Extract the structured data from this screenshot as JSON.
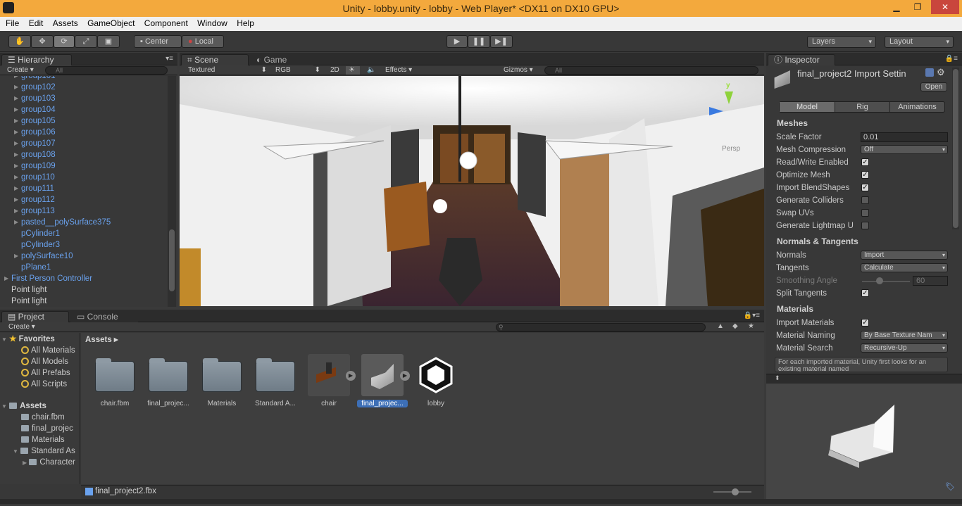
{
  "window": {
    "title": "Unity - lobby.unity - lobby - Web Player* <DX11 on DX10 GPU>"
  },
  "menu": [
    "File",
    "Edit",
    "Assets",
    "GameObject",
    "Component",
    "Window",
    "Help"
  ],
  "toolbar": {
    "pivot": "Center",
    "space": "Local",
    "layers": "Layers",
    "layout": "Layout"
  },
  "hierarchy": {
    "tab": "Hierarchy",
    "create": "Create",
    "search_placeholder": "All",
    "items": [
      {
        "label": "group101",
        "level": 1,
        "expandable": true,
        "prefab": true
      },
      {
        "label": "group102",
        "level": 1,
        "expandable": true,
        "prefab": true
      },
      {
        "label": "group103",
        "level": 1,
        "expandable": true,
        "prefab": true
      },
      {
        "label": "group104",
        "level": 1,
        "expandable": true,
        "prefab": true
      },
      {
        "label": "group105",
        "level": 1,
        "expandable": true,
        "prefab": true
      },
      {
        "label": "group106",
        "level": 1,
        "expandable": true,
        "prefab": true
      },
      {
        "label": "group107",
        "level": 1,
        "expandable": true,
        "prefab": true
      },
      {
        "label": "group108",
        "level": 1,
        "expandable": true,
        "prefab": true
      },
      {
        "label": "group109",
        "level": 1,
        "expandable": true,
        "prefab": true
      },
      {
        "label": "group110",
        "level": 1,
        "expandable": true,
        "prefab": true
      },
      {
        "label": "group111",
        "level": 1,
        "expandable": true,
        "prefab": true
      },
      {
        "label": "group112",
        "level": 1,
        "expandable": true,
        "prefab": true
      },
      {
        "label": "group113",
        "level": 1,
        "expandable": true,
        "prefab": true
      },
      {
        "label": "pasted__polySurface375",
        "level": 1,
        "expandable": true,
        "prefab": true
      },
      {
        "label": "pCylinder1",
        "level": 1,
        "expandable": false,
        "prefab": true
      },
      {
        "label": "pCylinder3",
        "level": 1,
        "expandable": false,
        "prefab": true
      },
      {
        "label": "polySurface10",
        "level": 1,
        "expandable": true,
        "prefab": true
      },
      {
        "label": "pPlane1",
        "level": 1,
        "expandable": false,
        "prefab": true
      },
      {
        "label": "First Person Controller",
        "level": 0,
        "expandable": true,
        "prefab": true
      },
      {
        "label": "Point light",
        "level": 0,
        "expandable": false,
        "prefab": false
      },
      {
        "label": "Point light",
        "level": 0,
        "expandable": false,
        "prefab": false
      }
    ]
  },
  "scene": {
    "tabs": [
      "Scene",
      "Game"
    ],
    "shading": "Textured",
    "render": "RGB",
    "mode2d": "2D",
    "effects": "Effects",
    "gizmos": "Gizmos",
    "search_placeholder": "All",
    "gizmo_axis": "y",
    "projection": "Persp"
  },
  "inspector": {
    "tab": "Inspector",
    "title": "final_project2 Import Settin",
    "open": "Open",
    "tabs": [
      "Model",
      "Rig",
      "Animations"
    ],
    "sections": {
      "meshes": "Meshes",
      "normals": "Normals & Tangents",
      "materials": "Materials"
    },
    "meshes": {
      "scale_factor_label": "Scale Factor",
      "scale_factor": "0.01",
      "mesh_compression_label": "Mesh Compression",
      "mesh_compression": "Off",
      "read_write_label": "Read/Write Enabled",
      "optimize_label": "Optimize Mesh",
      "blendshapes_label": "Import BlendShapes",
      "colliders_label": "Generate Colliders",
      "swap_uvs_label": "Swap UVs",
      "lightmap_label": "Generate Lightmap U"
    },
    "normals": {
      "normals_label": "Normals",
      "normals": "Import",
      "tangents_label": "Tangents",
      "tangents": "Calculate",
      "smoothing_label": "Smoothing Angle",
      "smoothing": "60",
      "smoothing_fraction": 0.33,
      "split_label": "Split Tangents"
    },
    "materials": {
      "import_label": "Import Materials",
      "naming_label": "Material Naming",
      "naming": "By Base Texture Nam",
      "search_label": "Material Search",
      "search": "Recursive-Up",
      "help": "For each imported material, Unity first looks for an existing material named"
    }
  },
  "project": {
    "tabs": [
      "Project",
      "Console"
    ],
    "create": "Create",
    "favorites_label": "Favorites",
    "favorites": [
      "All Materials",
      "All Models",
      "All Prefabs",
      "All Scripts"
    ],
    "assets_label": "Assets",
    "tree": [
      "chair.fbm",
      "final_projec",
      "Materials",
      "Standard As",
      "Character"
    ],
    "breadcrumb": "Assets",
    "assets": [
      {
        "label": "chair.fbm",
        "kind": "folder"
      },
      {
        "label": "final_projec...",
        "kind": "folder"
      },
      {
        "label": "Materials",
        "kind": "folder"
      },
      {
        "label": "Standard A...",
        "kind": "folder"
      },
      {
        "label": "chair",
        "kind": "model"
      },
      {
        "label": "final_projec...",
        "kind": "model-selected"
      },
      {
        "label": "lobby",
        "kind": "unity"
      }
    ],
    "status_file": "final_project2.fbx"
  },
  "colors": {
    "accent": "#f3a93d",
    "prefab_blue": "#6aa2ee",
    "selection": "#3d6fb6"
  }
}
